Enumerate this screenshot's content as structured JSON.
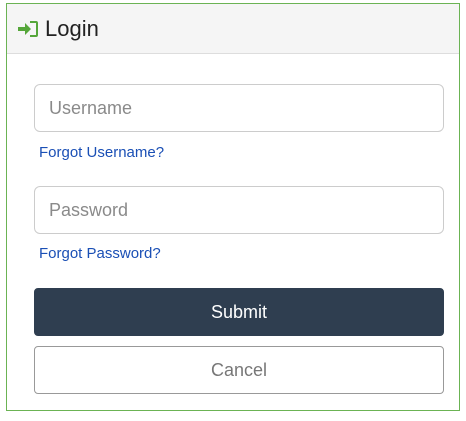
{
  "panel": {
    "title": "Login",
    "icon": "sign-in-icon"
  },
  "form": {
    "username_placeholder": "Username",
    "username_value": "",
    "forgot_username_label": "Forgot Username?",
    "password_placeholder": "Password",
    "password_value": "",
    "forgot_password_label": "Forgot Password?",
    "submit_label": "Submit",
    "cancel_label": "Cancel"
  },
  "colors": {
    "accent": "#6bb354",
    "link": "#1a4fb5",
    "submit_bg": "#2f3e50"
  }
}
